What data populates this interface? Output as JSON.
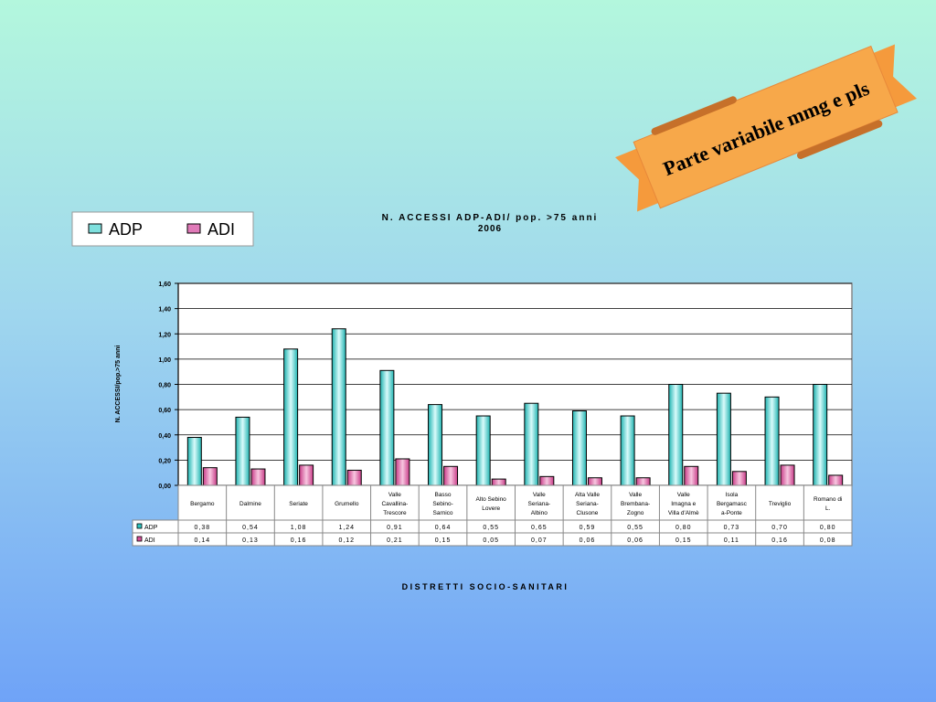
{
  "banner": {
    "text": "Parte variabile mmg e pls"
  },
  "chart_data": {
    "type": "bar",
    "title": "N. ACCESSI ADP-ADI/ pop. >75 anni",
    "subtitle": "2006",
    "xlabel": "DISTRETTI SOCIO-SANITARI",
    "ylabel": "N. ACCESSI/pop.>75 anni",
    "ylim": [
      0,
      1.6
    ],
    "yticks": [
      "0,00",
      "0,20",
      "0,40",
      "0,60",
      "0,80",
      "1,00",
      "1,20",
      "1,40",
      "1,60"
    ],
    "grid": true,
    "legend": "top-left",
    "categories": [
      [
        "Bergamo"
      ],
      [
        "Dalmine"
      ],
      [
        "Seriate"
      ],
      [
        "Grumello"
      ],
      [
        "Valle",
        "Cavallina-",
        "Trescore"
      ],
      [
        "Basso",
        "Sebino-",
        "Sarnico"
      ],
      [
        "Alto Sebino",
        "Lovere"
      ],
      [
        "Valle",
        "Seriana-",
        "Albino"
      ],
      [
        "Alta Valle",
        "Seriana-",
        "Clusone"
      ],
      [
        "Valle",
        "Brembana-",
        "Zogno"
      ],
      [
        "Valle",
        "Imagna e",
        "Villa d'Almè"
      ],
      [
        "Isola",
        "Bergamasc",
        "a-Ponte"
      ],
      [
        "Treviglio"
      ],
      [
        "Romano di",
        "L."
      ]
    ],
    "series": [
      {
        "name": "ADP",
        "color": "#2ec4c0",
        "values": [
          0.38,
          0.54,
          1.08,
          1.24,
          0.91,
          0.64,
          0.55,
          0.65,
          0.59,
          0.55,
          0.8,
          0.73,
          0.7,
          0.8
        ],
        "labels": [
          "0,38",
          "0,54",
          "1,08",
          "1,24",
          "0,91",
          "0,64",
          "0,55",
          "0,65",
          "0,59",
          "0,55",
          "0,80",
          "0,73",
          "0,70",
          "0,80"
        ]
      },
      {
        "name": "ADI",
        "color": "#d9509a",
        "values": [
          0.14,
          0.13,
          0.16,
          0.12,
          0.21,
          0.15,
          0.05,
          0.07,
          0.06,
          0.06,
          0.15,
          0.11,
          0.16,
          0.08
        ],
        "labels": [
          "0,14",
          "0,13",
          "0,16",
          "0,12",
          "0,21",
          "0,15",
          "0,05",
          "0,07",
          "0,06",
          "0,06",
          "0,15",
          "0,11",
          "0,16",
          "0,08"
        ]
      }
    ]
  }
}
